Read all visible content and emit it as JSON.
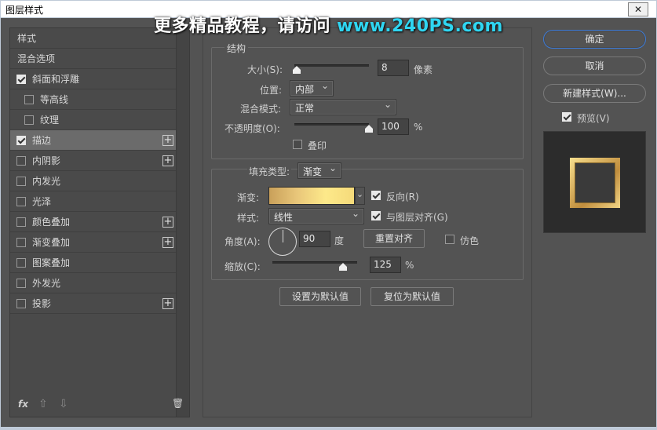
{
  "window": {
    "title": "图层样式",
    "close_icon": "close-icon"
  },
  "watermark": {
    "text": "更多精品教程，请访问 ",
    "url": "www.240PS.com"
  },
  "stylelist": {
    "header": "样式",
    "blend": "混合选项",
    "items": [
      {
        "label": "斜面和浮雕",
        "checked": true,
        "indent": false,
        "plus": false
      },
      {
        "label": "等高线",
        "checked": false,
        "indent": true,
        "plus": false
      },
      {
        "label": "纹理",
        "checked": false,
        "indent": true,
        "plus": false
      },
      {
        "label": "描边",
        "checked": true,
        "indent": false,
        "plus": true,
        "selected": true
      },
      {
        "label": "内阴影",
        "checked": false,
        "indent": false,
        "plus": true
      },
      {
        "label": "内发光",
        "checked": false,
        "indent": false,
        "plus": false
      },
      {
        "label": "光泽",
        "checked": false,
        "indent": false,
        "plus": false
      },
      {
        "label": "颜色叠加",
        "checked": false,
        "indent": false,
        "plus": true
      },
      {
        "label": "渐变叠加",
        "checked": false,
        "indent": false,
        "plus": true
      },
      {
        "label": "图案叠加",
        "checked": false,
        "indent": false,
        "plus": false
      },
      {
        "label": "外发光",
        "checked": false,
        "indent": false,
        "plus": false
      },
      {
        "label": "投影",
        "checked": false,
        "indent": false,
        "plus": true
      }
    ],
    "footer": {
      "fx": "fx",
      "up": "⇧",
      "down": "⇩",
      "trash": "🗑"
    }
  },
  "structure": {
    "title": "结构",
    "size_label": "大小(S):",
    "size_value": "8",
    "size_unit": "像素",
    "size_fraction": 0.03,
    "position_label": "位置:",
    "position_value": "内部",
    "blend_label": "混合模式:",
    "blend_value": "正常",
    "opacity_label": "不透明度(O):",
    "opacity_value": "100",
    "opacity_unit": "%",
    "opacity_fraction": 1.0,
    "overprint_label": "叠印",
    "overprint_checked": false
  },
  "fill": {
    "type_label": "填充类型:",
    "type_value": "渐变",
    "gradient_label": "渐变:",
    "gradient_colors": [
      "#c9a05a",
      "#e9c77a",
      "#fde98a",
      "#f5da7a"
    ],
    "reverse_label": "反向(R)",
    "reverse_checked": true,
    "style_label": "样式:",
    "style_value": "线性",
    "align_label": "与图层对齐(G)",
    "align_checked": true,
    "angle_label": "角度(A):",
    "angle_value": "90",
    "angle_unit": "度",
    "reset_align_label": "重置对齐",
    "dither_label": "仿色",
    "dither_checked": false,
    "scale_label": "缩放(C):",
    "scale_value": "125",
    "scale_unit": "%",
    "scale_fraction": 0.83
  },
  "actions": {
    "set_default": "设置为默认值",
    "reset_default": "复位为默认值",
    "ok": "确定",
    "cancel": "取消",
    "new_style": "新建样式(W)...",
    "preview_label": "预览(V)",
    "preview_checked": true
  },
  "colors": {
    "panel": "#535353",
    "accent": "#3c7ad6",
    "url": "#2fd6f2"
  }
}
